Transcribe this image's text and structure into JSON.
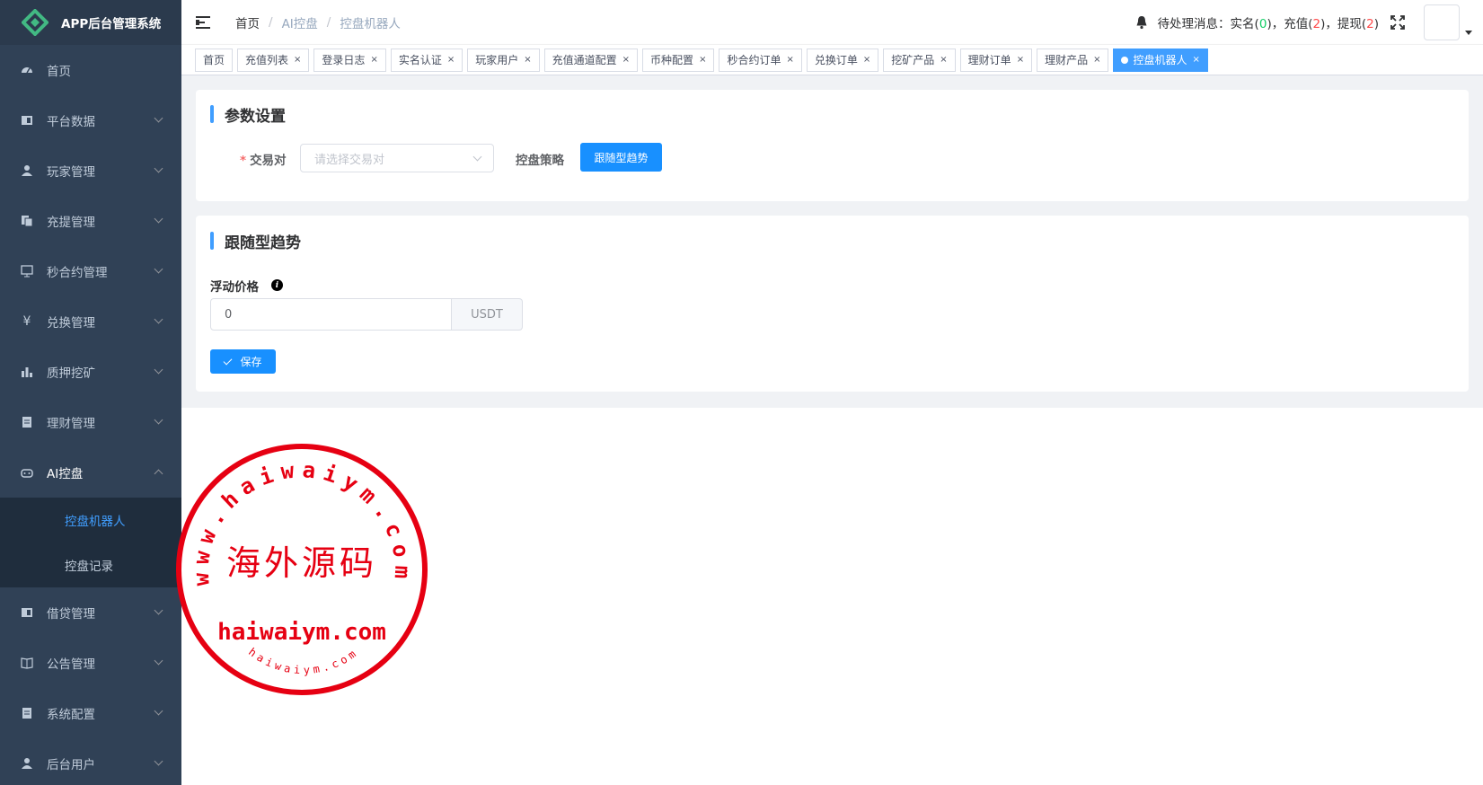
{
  "app": {
    "title": "APP后台管理系统"
  },
  "sidebar": {
    "items": [
      {
        "label": "首页",
        "icon": "dashboard-icon"
      },
      {
        "label": "平台数据",
        "icon": "data-icon"
      },
      {
        "label": "玩家管理",
        "icon": "user-icon"
      },
      {
        "label": "充提管理",
        "icon": "copy-icon"
      },
      {
        "label": "秒合约管理",
        "icon": "monitor-icon"
      },
      {
        "label": "兑换管理",
        "icon": "yen-icon"
      },
      {
        "label": "质押挖矿",
        "icon": "bar-chart-icon"
      },
      {
        "label": "理财管理",
        "icon": "document-icon"
      },
      {
        "label": "AI控盘",
        "icon": "robot-icon"
      },
      {
        "label": "借贷管理",
        "icon": "book-icon"
      },
      {
        "label": "公告管理",
        "icon": "open-book-icon"
      },
      {
        "label": "系统配置",
        "icon": "settings-doc-icon"
      },
      {
        "label": "后台用户",
        "icon": "users-icon"
      }
    ],
    "ai_submenu": [
      {
        "label": "控盘机器人"
      },
      {
        "label": "控盘记录"
      }
    ]
  },
  "header": {
    "breadcrumb": [
      "首页",
      "AI控盘",
      "控盘机器人"
    ],
    "notice_label": "待处理消息：实名(",
    "realname_count": "0",
    "recharge_label": ")，充值(",
    "recharge_count": "2",
    "withdraw_label": ")，提现(",
    "withdraw_count": "2",
    "close_paren": ")"
  },
  "tags": [
    {
      "label": "首页",
      "closable": false
    },
    {
      "label": "充值列表",
      "closable": true
    },
    {
      "label": "登录日志",
      "closable": true
    },
    {
      "label": "实名认证",
      "closable": true
    },
    {
      "label": "玩家用户",
      "closable": true
    },
    {
      "label": "充值通道配置",
      "closable": true
    },
    {
      "label": "币种配置",
      "closable": true
    },
    {
      "label": "秒合约订单",
      "closable": true
    },
    {
      "label": "兑换订单",
      "closable": true
    },
    {
      "label": "挖矿产品",
      "closable": true
    },
    {
      "label": "理财订单",
      "closable": true
    },
    {
      "label": "理财产品",
      "closable": true
    },
    {
      "label": "控盘机器人",
      "closable": true,
      "active": true
    }
  ],
  "params": {
    "title": "参数设置",
    "pair_label": "交易对",
    "pair_placeholder": "请选择交易对",
    "strategy_label": "控盘策略",
    "strategy_button": "跟随型趋势"
  },
  "trend": {
    "title": "跟随型趋势",
    "float_label": "浮动价格",
    "float_value": "0",
    "unit": "USDT",
    "save_label": "保存"
  },
  "watermark": {
    "arc_text": "www.haiwaiym.com",
    "center_text": "海外源码",
    "domain_text": "haiwaiym.com",
    "small_text": "haiwaiym.com"
  },
  "colors": {
    "primary": "#1890ff",
    "sidebar_bg": "#304156",
    "submenu_bg": "#1f2d3d",
    "stamp": "#e60012"
  }
}
